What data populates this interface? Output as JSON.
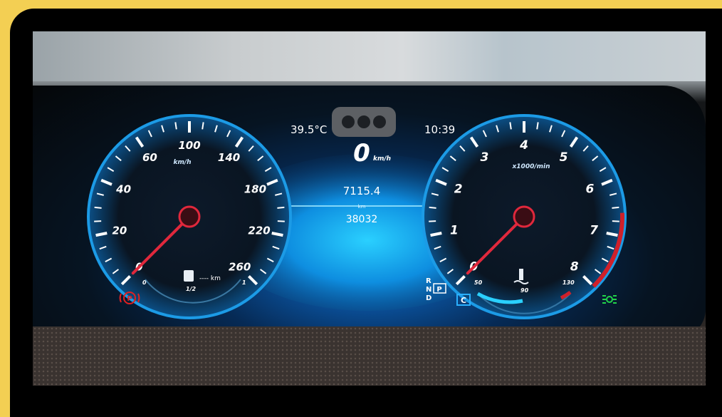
{
  "status": {
    "temperature": "39.5°C",
    "clock": "10:39"
  },
  "speed": {
    "value": "0",
    "unit": "km/h"
  },
  "center": {
    "trip": "7115.4",
    "trip_unit": "km",
    "odometer": "38032"
  },
  "speedometer": {
    "unit_label": "km/h",
    "labels": [
      "0",
      "20",
      "40",
      "60",
      "100",
      "140",
      "180",
      "220",
      "260"
    ],
    "needle_value": 0,
    "fuel_range": "---- km",
    "fuel_scale_empty": "0",
    "fuel_scale_half": "1/2",
    "fuel_scale_full": "1",
    "parking_brake_icon": "parking-brake-warning",
    "parking_brake_color": "#e02020"
  },
  "tachometer": {
    "unit_label": "x1000/min",
    "labels": [
      "0",
      "1",
      "2",
      "3",
      "4",
      "5",
      "6",
      "7",
      "8"
    ],
    "needle_value": 0,
    "coolant_labels": [
      "50",
      "90",
      "130"
    ],
    "coolant_icon": "coolant-temperature-icon",
    "lights_icon": "parking-lights-indicator",
    "lights_color": "#22d34a",
    "redline_color": "#d0202a"
  },
  "gear": {
    "letters": [
      "R",
      "N",
      "D"
    ],
    "selected": "P",
    "mode": "C"
  },
  "colors": {
    "accent": "#1aa6ff",
    "needle": "#e0283c",
    "frame": "#f3cf53"
  }
}
